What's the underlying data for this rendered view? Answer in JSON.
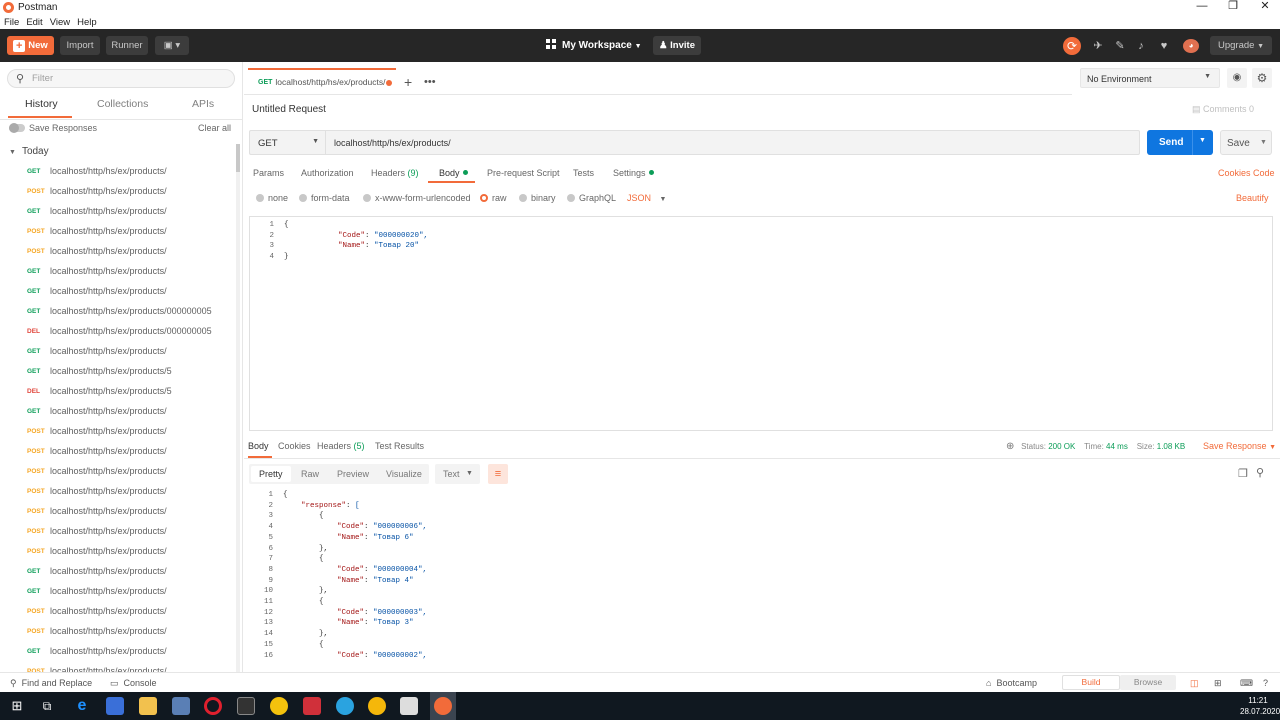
{
  "window": {
    "title": "Postman",
    "minimize": "—",
    "maximize": "❐",
    "close": "✕"
  },
  "menu": [
    "File",
    "Edit",
    "View",
    "Help"
  ],
  "header": {
    "new_label": "New",
    "import_label": "Import",
    "runner_label": "Runner",
    "workspace_label": "My Workspace",
    "invite_label": "Invite",
    "upgrade_label": "Upgrade"
  },
  "sidebar": {
    "filter_placeholder": "Filter",
    "tabs": [
      "History",
      "Collections",
      "APIs"
    ],
    "save_responses": "Save Responses",
    "clear_all": "Clear all",
    "group": "Today",
    "items": [
      {
        "method": "GET",
        "url": "localhost/http/hs/ex/products/"
      },
      {
        "method": "POST",
        "url": "localhost/http/hs/ex/products/"
      },
      {
        "method": "GET",
        "url": "localhost/http/hs/ex/products/"
      },
      {
        "method": "POST",
        "url": "localhost/http/hs/ex/products/"
      },
      {
        "method": "POST",
        "url": "localhost/http/hs/ex/products/"
      },
      {
        "method": "GET",
        "url": "localhost/http/hs/ex/products/"
      },
      {
        "method": "GET",
        "url": "localhost/http/hs/ex/products/"
      },
      {
        "method": "GET",
        "url": "localhost/http/hs/ex/products/000000005"
      },
      {
        "method": "DEL",
        "url": "localhost/http/hs/ex/products/000000005"
      },
      {
        "method": "GET",
        "url": "localhost/http/hs/ex/products/"
      },
      {
        "method": "GET",
        "url": "localhost/http/hs/ex/products/5"
      },
      {
        "method": "DEL",
        "url": "localhost/http/hs/ex/products/5"
      },
      {
        "method": "GET",
        "url": "localhost/http/hs/ex/products/"
      },
      {
        "method": "POST",
        "url": "localhost/http/hs/ex/products/"
      },
      {
        "method": "POST",
        "url": "localhost/http/hs/ex/products/"
      },
      {
        "method": "POST",
        "url": "localhost/http/hs/ex/products/"
      },
      {
        "method": "POST",
        "url": "localhost/http/hs/ex/products/"
      },
      {
        "method": "POST",
        "url": "localhost/http/hs/ex/products/"
      },
      {
        "method": "POST",
        "url": "localhost/http/hs/ex/products/"
      },
      {
        "method": "POST",
        "url": "localhost/http/hs/ex/products/"
      },
      {
        "method": "GET",
        "url": "localhost/http/hs/ex/products/"
      },
      {
        "method": "GET",
        "url": "localhost/http/hs/ex/products/"
      },
      {
        "method": "POST",
        "url": "localhost/http/hs/ex/products/"
      },
      {
        "method": "POST",
        "url": "localhost/http/hs/ex/products/"
      },
      {
        "method": "GET",
        "url": "localhost/http/hs/ex/products/"
      },
      {
        "method": "POST",
        "url": "localhost/http/hs/ex/products/"
      }
    ]
  },
  "tab": {
    "method": "GET",
    "url": "localhost/http/hs/ex/products/"
  },
  "environment": {
    "selected": "No Environment"
  },
  "request": {
    "name": "Untitled Request",
    "comments": "Comments",
    "comments_count": "0",
    "method": "GET",
    "url": "localhost/http/hs/ex/products/",
    "send_label": "Send",
    "save_label": "Save",
    "tabs": [
      "Params",
      "Authorization",
      "Headers",
      "Body",
      "Pre-request Script",
      "Tests",
      "Settings"
    ],
    "headers_count": "(9)",
    "cookies_label": "Cookies",
    "code_label": "Code",
    "body_types": [
      "none",
      "form-data",
      "x-www-form-urlencoded",
      "raw",
      "binary",
      "GraphQL"
    ],
    "body_format": "JSON",
    "beautify": "Beautify",
    "body_lines": [
      {
        "n": "1",
        "text": "{"
      },
      {
        "n": "2",
        "text": "\"Code\": \"000000020\","
      },
      {
        "n": "3",
        "text": "\"Name\": \"Товар 20\""
      },
      {
        "n": "4",
        "text": "}"
      }
    ]
  },
  "response": {
    "tabs": [
      "Body",
      "Cookies",
      "Headers",
      "Test Results"
    ],
    "headers_count": "(5)",
    "status_label": "Status:",
    "status_value": "200 OK",
    "time_label": "Time:",
    "time_value": "44 ms",
    "size_label": "Size:",
    "size_value": "1.08 KB",
    "save_response": "Save Response",
    "views": [
      "Pretty",
      "Raw",
      "Preview",
      "Visualize"
    ],
    "format": "Text",
    "lines": [
      {
        "n": "1",
        "text": "{"
      },
      {
        "n": "2",
        "text": "\"response\": ["
      },
      {
        "n": "3",
        "text": "{"
      },
      {
        "n": "4",
        "text": "\"Code\": \"000000006\","
      },
      {
        "n": "5",
        "text": "\"Name\": \"Товар 6\""
      },
      {
        "n": "6",
        "text": "},"
      },
      {
        "n": "7",
        "text": "{"
      },
      {
        "n": "8",
        "text": "\"Code\": \"000000004\","
      },
      {
        "n": "9",
        "text": "\"Name\": \"Товар 4\""
      },
      {
        "n": "10",
        "text": "},"
      },
      {
        "n": "11",
        "text": "{"
      },
      {
        "n": "12",
        "text": "\"Code\": \"000000003\","
      },
      {
        "n": "13",
        "text": "\"Name\": \"Товар 3\""
      },
      {
        "n": "14",
        "text": "},"
      },
      {
        "n": "15",
        "text": "{"
      },
      {
        "n": "16",
        "text": "\"Code\": \"000000002\","
      }
    ]
  },
  "statusbar": {
    "find_replace": "Find and Replace",
    "console": "Console",
    "bootcamp": "Bootcamp",
    "build": "Build",
    "browse": "Browse"
  },
  "taskbar": {
    "time": "11:21",
    "date": "28.07.2020"
  },
  "colors": {
    "accent": "#f26b3a",
    "send": "#0f76e0",
    "get": "#0c9d58",
    "post": "#f5a623",
    "del": "#e0443a"
  }
}
